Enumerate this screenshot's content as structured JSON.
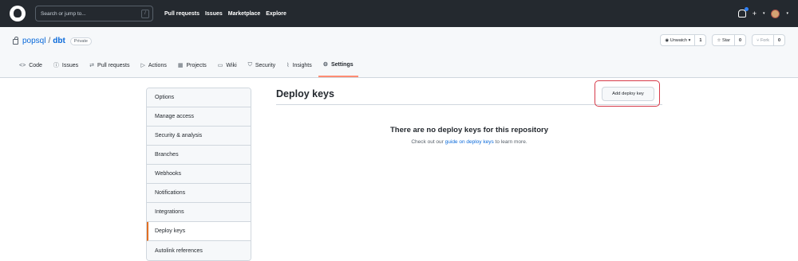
{
  "header": {
    "search_placeholder": "Search or jump to...",
    "search_shortcut": "/",
    "nav": [
      "Pull requests",
      "Issues",
      "Marketplace",
      "Explore"
    ],
    "plus": "+",
    "caret": "▾"
  },
  "repo": {
    "owner": "popsql",
    "separator": "/",
    "name": "dbt",
    "visibility": "Private",
    "actions": {
      "watch": {
        "label": "Unwatch",
        "count": "1"
      },
      "star": {
        "label": "Star",
        "count": "0"
      },
      "fork": {
        "label": "Fork",
        "count": "0"
      }
    },
    "tabs": [
      {
        "icon": "<>",
        "label": "Code"
      },
      {
        "icon": "ⓘ",
        "label": "Issues"
      },
      {
        "icon": "⇄",
        "label": "Pull requests"
      },
      {
        "icon": "▷",
        "label": "Actions"
      },
      {
        "icon": "▦",
        "label": "Projects"
      },
      {
        "icon": "▭",
        "label": "Wiki"
      },
      {
        "icon": "⛉",
        "label": "Security"
      },
      {
        "icon": "⌇",
        "label": "Insights"
      },
      {
        "icon": "⚙",
        "label": "Settings"
      }
    ]
  },
  "sidebar": {
    "items": [
      "Options",
      "Manage access",
      "Security & analysis",
      "Branches",
      "Webhooks",
      "Notifications",
      "Integrations",
      "Deploy keys",
      "Autolink references"
    ],
    "selected": "Deploy keys"
  },
  "main": {
    "title": "Deploy keys",
    "add_button": "Add deploy key",
    "empty_title": "There are no deploy keys for this repository",
    "empty_prefix": "Check out our",
    "empty_link": "guide on deploy keys",
    "empty_suffix": "to learn more."
  },
  "colors": {
    "header_bg": "#24292f",
    "link": "#0969da",
    "selected_tab_underline": "#fd8c73",
    "selected_sidebar_bar": "#e16f24",
    "highlight_ring": "#d73a49"
  }
}
